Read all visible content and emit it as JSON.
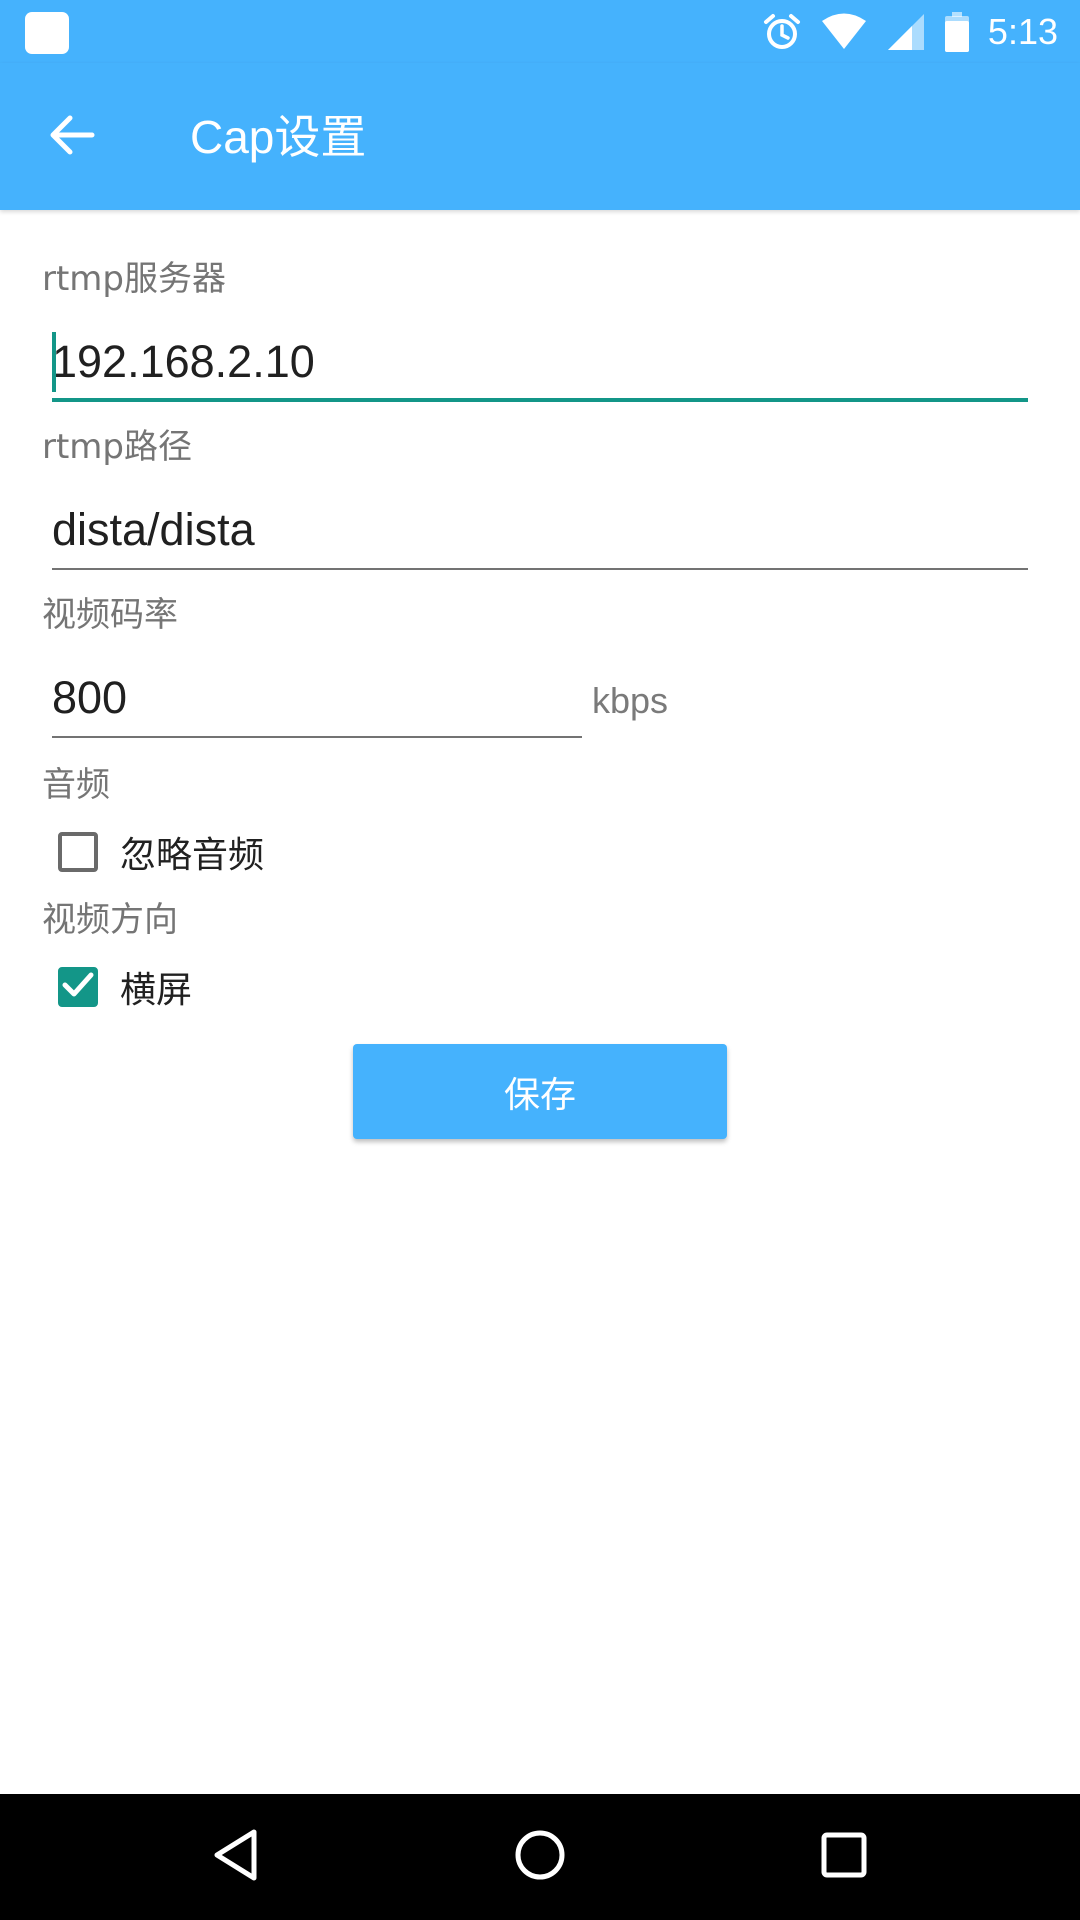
{
  "status_bar": {
    "time": "5:13",
    "icons": [
      "app-icon",
      "alarm-icon",
      "wifi-icon",
      "signal-icon",
      "battery-icon"
    ]
  },
  "app_bar": {
    "title": "Cap设置",
    "back_icon": "arrow-back-icon"
  },
  "form": {
    "rtmp_server": {
      "label": "rtmp服务器",
      "value": "192.168.2.10"
    },
    "rtmp_path": {
      "label": "rtmp路径",
      "value": "dista/dista"
    },
    "video_bitrate": {
      "label": "视频码率",
      "value": "800",
      "unit": "kbps"
    },
    "audio": {
      "label": "音频",
      "ignore_audio_label": "忽略音频",
      "ignore_audio_checked": false
    },
    "orientation": {
      "label": "视频方向",
      "landscape_label": "横屏",
      "landscape_checked": true
    },
    "save_label": "保存"
  },
  "nav_bar": {
    "icons": [
      "back-triangle-icon",
      "home-circle-icon",
      "recents-square-icon"
    ]
  },
  "colors": {
    "primary": "#45b2fd",
    "accent": "#139688"
  }
}
